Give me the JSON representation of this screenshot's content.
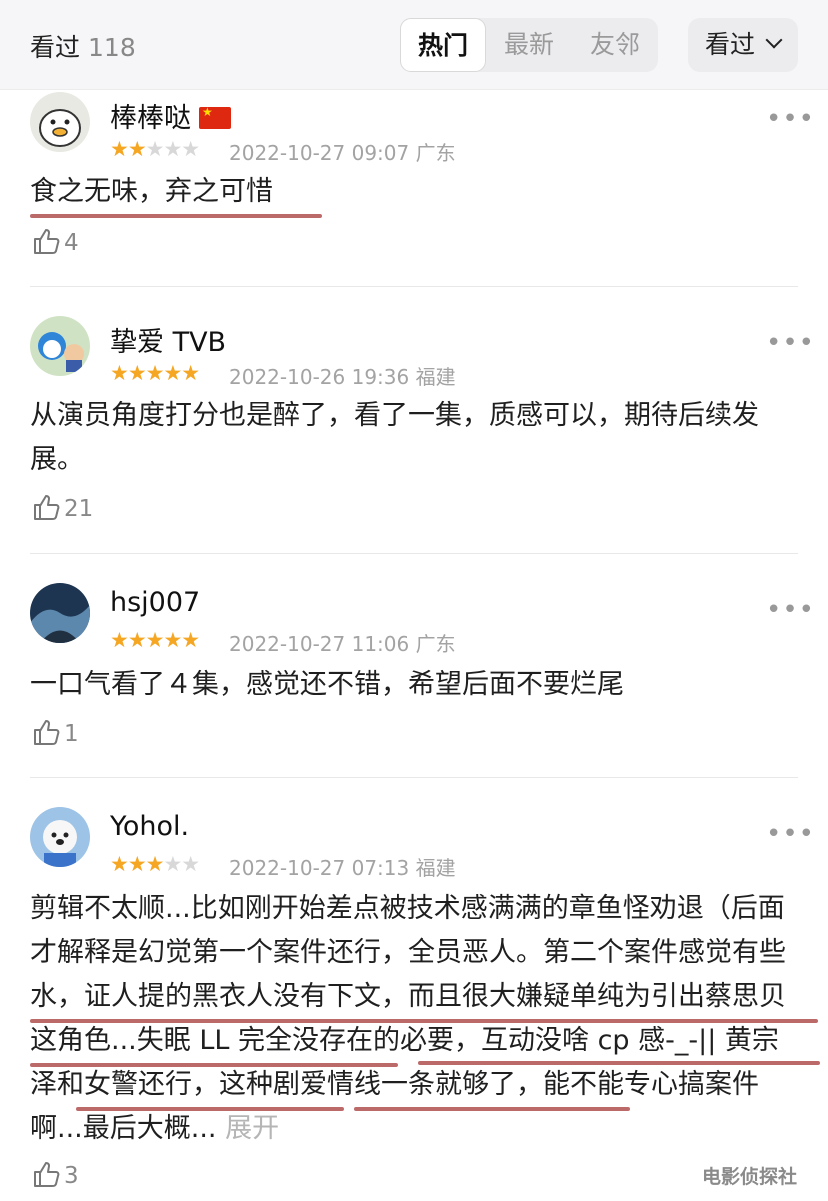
{
  "header": {
    "title": "看过",
    "count": "118",
    "tabs": [
      "热门",
      "最新",
      "友邻"
    ],
    "active_tab": "热门",
    "sort_label": "看过"
  },
  "reviews": [
    {
      "user": "棒棒哒",
      "flag": "china-flag",
      "rating": 2,
      "timestamp": "2022-10-27 09:07",
      "location": "广东",
      "text": "食之无味，弃之可惜",
      "likes": "4"
    },
    {
      "user": "挚爱 TVB",
      "rating": 5,
      "timestamp": "2022-10-26 19:36",
      "location": "福建",
      "text": "从演员角度打分也是醉了，看了一集，质感可以，期待后续发展。",
      "likes": "21"
    },
    {
      "user": "hsj007",
      "rating": 5,
      "timestamp": "2022-10-27 11:06",
      "location": "广东",
      "text": "一口气看了４集，感觉还不错，希望后面不要烂尾",
      "likes": "1"
    },
    {
      "user": "Yohol.",
      "rating": 3,
      "timestamp": "2022-10-27 07:13",
      "location": "福建",
      "text": "剪辑不太顺...比如刚开始差点被技术感满满的章鱼怪劝退（后面才解释是幻觉第一个案件还行，全员恶人。第二个案件感觉有些水，证人提的黑衣人没有下文，而且很大嫌疑单纯为引出蔡思贝这角色...失眠 LL 完全没存在的必要，互动没啥 cp 感-_-|| 黄宗泽和女警还行，这种剧爱情线一条就够了，能不能专心搞案件啊...最后大概...",
      "expand_label": "展开",
      "likes": "3"
    }
  ],
  "watermark": "电影侦探社",
  "colors": {
    "star": "#f5a623",
    "underline": "#b0504f",
    "header_bg": "#f6f6f8"
  }
}
